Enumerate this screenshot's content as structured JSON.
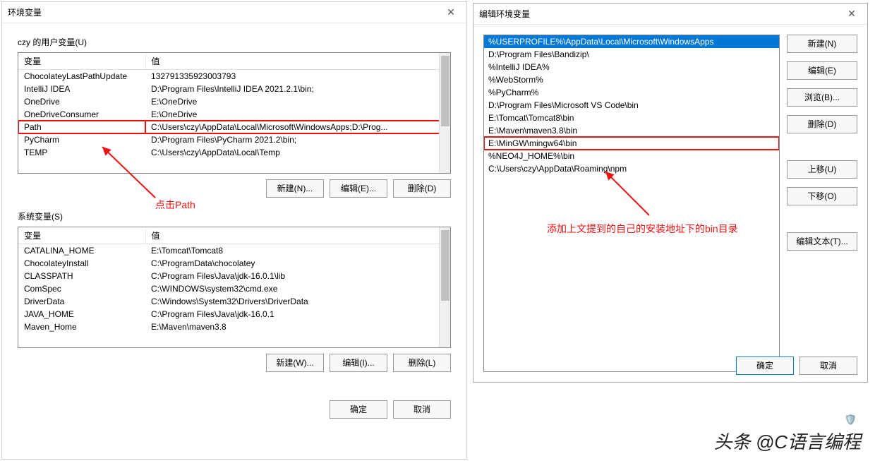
{
  "left_dialog": {
    "title": "环境变量",
    "user_vars_label": "czy 的用户变量(U)",
    "sys_vars_label": "系统变量(S)",
    "col_var": "变量",
    "col_val": "值",
    "user_vars": [
      {
        "name": "ChocolateyLastPathUpdate",
        "value": "132791335923003793"
      },
      {
        "name": "IntelliJ IDEA",
        "value": "D:\\Program Files\\IntelliJ IDEA 2021.2.1\\bin;"
      },
      {
        "name": "OneDrive",
        "value": "E:\\OneDrive"
      },
      {
        "name": "OneDriveConsumer",
        "value": "E:\\OneDrive"
      },
      {
        "name": "Path",
        "value": "C:\\Users\\czy\\AppData\\Local\\Microsoft\\WindowsApps;D:\\Prog...",
        "highlight": true
      },
      {
        "name": "PyCharm",
        "value": "D:\\Program Files\\PyCharm 2021.2\\bin;"
      },
      {
        "name": "TEMP",
        "value": "C:\\Users\\czy\\AppData\\Local\\Temp"
      }
    ],
    "sys_vars": [
      {
        "name": "CATALINA_HOME",
        "value": "E:\\Tomcat\\Tomcat8"
      },
      {
        "name": "ChocolateyInstall",
        "value": "C:\\ProgramData\\chocolatey"
      },
      {
        "name": "CLASSPATH",
        "value": "C:\\Program Files\\Java\\jdk-16.0.1\\lib"
      },
      {
        "name": "ComSpec",
        "value": "C:\\WINDOWS\\system32\\cmd.exe"
      },
      {
        "name": "DriverData",
        "value": "C:\\Windows\\System32\\Drivers\\DriverData"
      },
      {
        "name": "JAVA_HOME",
        "value": "C:\\Program Files\\Java\\jdk-16.0.1"
      },
      {
        "name": "Maven_Home",
        "value": "E:\\Maven\\maven3.8"
      }
    ],
    "btn_new_n": "新建(N)...",
    "btn_edit_e": "编辑(E)...",
    "btn_del_d": "删除(D)",
    "btn_new_w": "新建(W)...",
    "btn_edit_i": "编辑(I)...",
    "btn_del_l": "删除(L)",
    "btn_ok": "确定",
    "btn_cancel": "取消"
  },
  "right_dialog": {
    "title": "编辑环境变量",
    "paths": [
      {
        "text": "%USERPROFILE%\\AppData\\Local\\Microsoft\\WindowsApps",
        "selected": true
      },
      {
        "text": "D:\\Program Files\\Bandizip\\"
      },
      {
        "text": "%IntelliJ IDEA%"
      },
      {
        "text": "%WebStorm%"
      },
      {
        "text": "%PyCharm%"
      },
      {
        "text": "D:\\Program Files\\Microsoft VS Code\\bin"
      },
      {
        "text": "E:\\Tomcat\\Tomcat8\\bin"
      },
      {
        "text": "E:\\Maven\\maven3.8\\bin"
      },
      {
        "text": "E:\\MinGW\\mingw64\\bin",
        "boxed": true
      },
      {
        "text": "%NEO4J_HOME%\\bin"
      },
      {
        "text": "C:\\Users\\czy\\AppData\\Roaming\\npm"
      }
    ],
    "btn_new": "新建(N)",
    "btn_edit": "编辑(E)",
    "btn_browse": "浏览(B)...",
    "btn_delete": "删除(D)",
    "btn_up": "上移(U)",
    "btn_down": "下移(O)",
    "btn_edit_text": "编辑文本(T)...",
    "btn_ok": "确定",
    "btn_cancel": "取消"
  },
  "annotations": {
    "click_path": "点击Path",
    "add_bin": "添加上文提到的自己的安装地址下的bin目录"
  },
  "watermark": "头条 @C语言编程"
}
